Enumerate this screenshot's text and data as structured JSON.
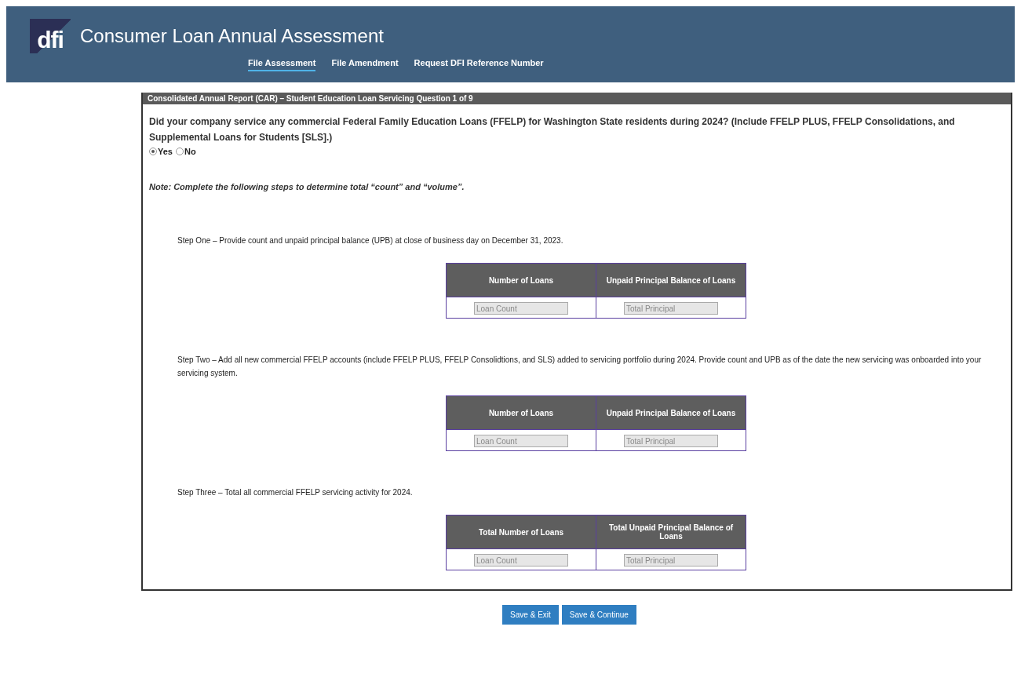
{
  "header": {
    "logo": "dfi",
    "title": "Consumer Loan Annual Assessment",
    "nav": [
      {
        "label": "File Assessment",
        "selected": true
      },
      {
        "label": "File Amendment",
        "selected": false
      },
      {
        "label": "Request DFI Reference Number",
        "selected": false
      }
    ]
  },
  "section": {
    "legend": "Consolidated Annual Report (CAR) – Student Education Loan Servicing Question 1 of 9",
    "question": "Did your company service any commercial Federal Family Education Loans (FFELP) for Washington State residents during 2024? (Include FFELP PLUS, FFELP Consolidations, and Supplemental Loans for Students [SLS].)",
    "options": [
      {
        "label": "Yes",
        "selected": true
      },
      {
        "label": "No",
        "selected": false
      }
    ],
    "note": "Note: Complete the following steps to determine total “count” and “volume”.",
    "steps": [
      {
        "text": "Step One – Provide count and unpaid principal balance (UPB) at close of business day on December 31, 2023.",
        "columns": [
          "Number of Loans",
          "Unpaid Principal Balance of Loans"
        ],
        "placeholders": [
          "Loan Count",
          "Total Principal"
        ]
      },
      {
        "text": "Step Two – Add all new commercial FFELP accounts (include FFELP PLUS, FFELP Consolidtions, and SLS) added to servicing portfolio during 2024. Provide count and UPB as of the date the new servicing was onboarded into your servicing system.",
        "columns": [
          "Number of Loans",
          "Unpaid Principal Balance of Loans"
        ],
        "placeholders": [
          "Loan Count",
          "Total Principal"
        ]
      },
      {
        "text": "Step Three – Total all commercial FFELP servicing activity for 2024.",
        "columns": [
          "Total Number of Loans",
          "Total Unpaid Principal Balance of Loans"
        ],
        "placeholders": [
          "Loan Count",
          "Total Principal"
        ]
      }
    ]
  },
  "buttons": [
    "Save & Exit",
    "Save & Continue"
  ]
}
